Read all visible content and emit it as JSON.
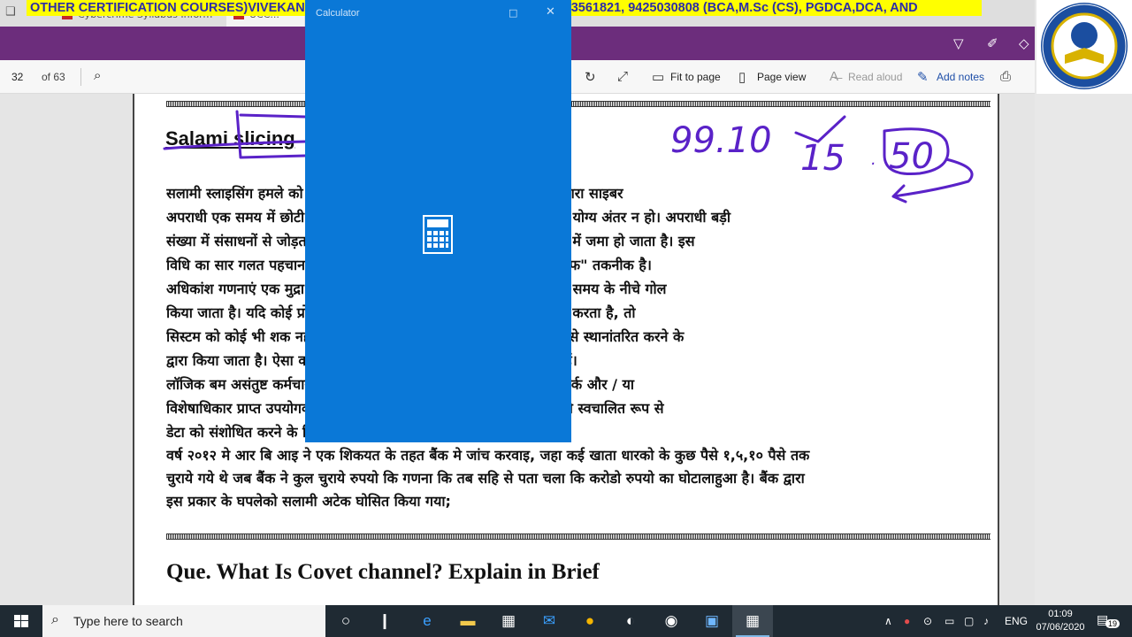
{
  "ticker": {
    "text": "OTHER CERTIFICATION COURSES)VIVEKANAND INSTITUTE OF I.T. BARWANI MOB. 9893561821, 9425030808 (BCA,M.Sc (CS), PGDCA,DCA, AND"
  },
  "tabs": [
    {
      "label": "Cybercrime Syllabus Inform"
    },
    {
      "label": "UCC..."
    }
  ],
  "toolbar": {
    "page_number": "32",
    "page_total": "of 63",
    "fit_to_page": "Fit to page",
    "page_view": "Page view",
    "read_aloud": "Read aloud",
    "add_notes": "Add notes"
  },
  "document": {
    "heading": "Salami slicing",
    "hindi_lines": [
      "सलामी स्लाइसिंग हमले को \"सलामी धोखाधड़ी\" एक ऐसी तकनीक है जिसके द्वारा साइबर",
      "अपराधी एक समय में छोटी राशि चुराते हैं ताकि समग्र आकार में कोई ध्यान देने योग्य अंतर न हो। अपराधी बड़ी",
      "संख्या में संसाधनों से जोड़ता रहता है, और इस तरह समय के साथ काफी मात्रा में जमा हो जाता है। इस",
      "विधि का सार गलत पहचान की है, इसे क्लासिक दृष्टिकोण \"कलेक्ट-ए-राउंडऑफ\" तकनीक है।",
      "अधिकांश गणनाएं एक मुद्रा में निकटतम संख्या में लगभग आधा समय और शेष समय के नीचे गोल",
      "किया जाता है। यदि कोई प्रोग्रामर को एक अलग खाते में जमा करने का फैसला करता है, तो",
      "सिस्टम को कोई भी शक नहीं होता, अपराधी के खाते में धनराशि को सावधानी से स्थानांतरित करने के",
      "द्वारा किया जाता है। ऐसा करने के लिए सिस्टम में एक प्रोग्राम सम्मिलित करते हैं।",
      "लॉजिक बम असंतुष्ट कर्मचारी द्वारा डाला जा सकता है जो अपने नेटवर्क के नेटवर्क और / या",
      "विशेषाधिकार प्राप्त उपयोगकर्ता हैं। इस में, अपराधी अंकगणितीय परिकलकों को स्वचालित रूप से",
      "डेटा को संशोधित करने के लिए प्रोग्राम गणना ।",
      "वर्ष २०१२ मे आर बि आइ ने एक शिकयत के तहत बैंक मे जांच करवाइ, जहा कई खाता धारको के कुछ पैसे १,५,१० पैसे तक",
      "चुराये गये थे जब बैंक ने कुल चुराये रुपयो कि गणना कि तब सहि से पता चला कि करोडो रुपयो का घोटालाहुआ है। बैंक द्वारा",
      "इस प्रकार के घपलेको सलामी अटेक घोसित किया गया;"
    ],
    "question": "Que. What Is Covet  channel? Explain in Brief"
  },
  "annotation": {
    "line1": "99.10",
    "line2": "15",
    "line3": "50"
  },
  "calculator": {
    "title": "Calculator",
    "accent": "#0a78d7"
  },
  "taskbar": {
    "search_placeholder": "Type here to search",
    "language": "ENG",
    "time": "01:09",
    "date": "07/06/2020",
    "notification_count": "19"
  }
}
